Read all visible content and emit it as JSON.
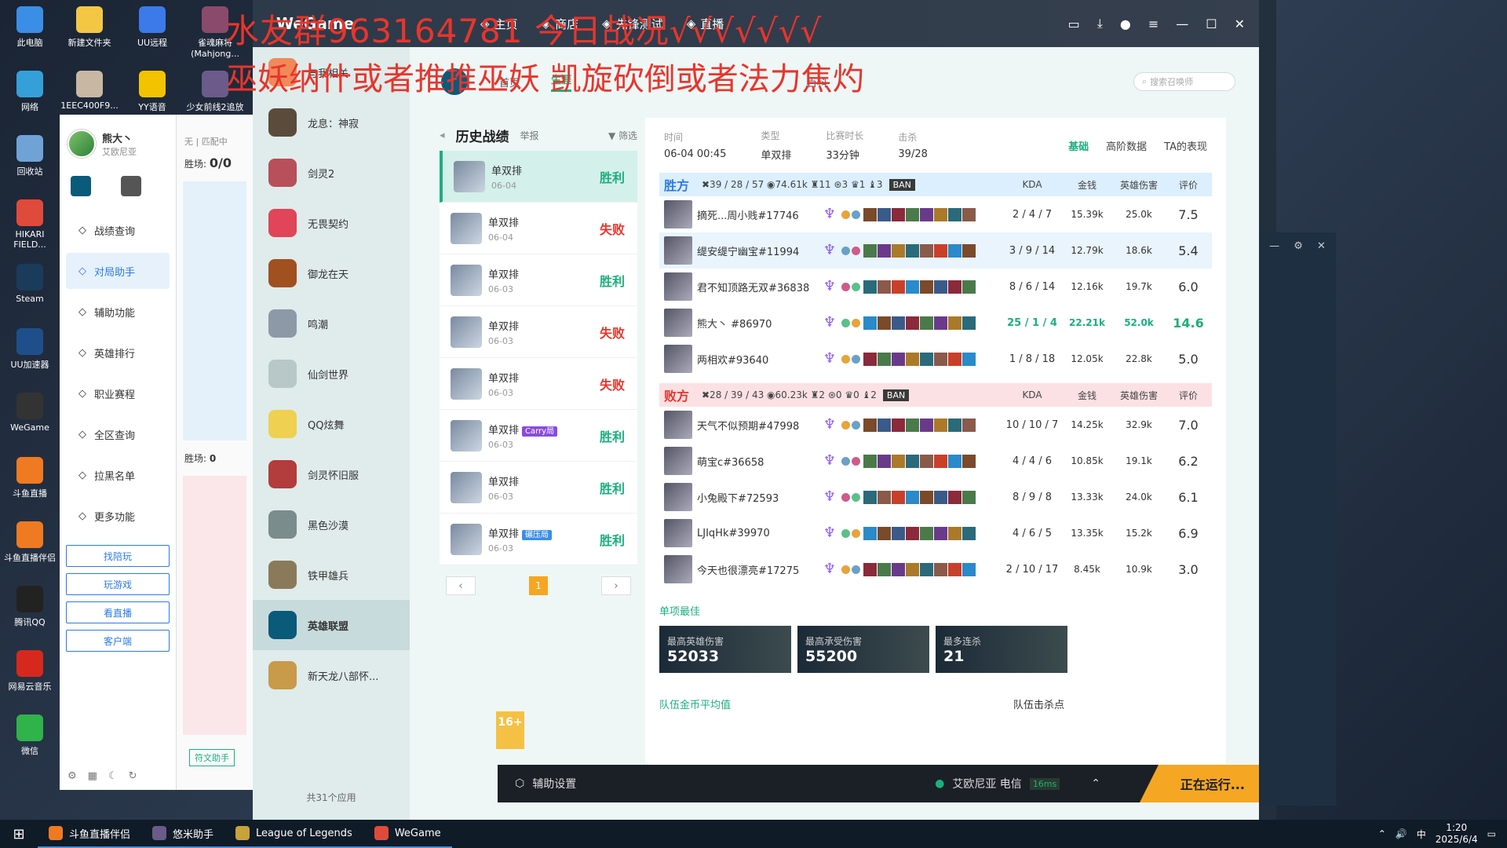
{
  "desktop": {
    "icons": [
      {
        "label": "此电脑",
        "color": "#3a8ee6"
      },
      {
        "label": "网络",
        "color": "#35a0d8"
      },
      {
        "label": "回收站",
        "color": "#6fa3d6"
      },
      {
        "label": "HIKARI FIELD...",
        "color": "#e04a3a"
      },
      {
        "label": "Steam",
        "color": "#1b3b5a"
      },
      {
        "label": "UU加速器",
        "color": "#1f4f8a"
      },
      {
        "label": "WeGame",
        "color": "#333"
      },
      {
        "label": "斗鱼直播",
        "color": "#f07a21"
      },
      {
        "label": "斗鱼直播伴侣",
        "color": "#f07a21"
      },
      {
        "label": "腾讯QQ",
        "color": "#222"
      },
      {
        "label": "网易云音乐",
        "color": "#d7281d"
      },
      {
        "label": "微信",
        "color": "#2fb34a"
      }
    ],
    "icons2": [
      [
        {
          "label": "新建文件夹",
          "color": "#f3c744"
        },
        {
          "label": "1EEC400F9...",
          "color": "#c8b7a3"
        }
      ],
      [
        {
          "label": "UU远程",
          "color": "#3b7ae8"
        },
        {
          "label": "YY语音",
          "color": "#f3c300"
        }
      ],
      [
        {
          "label": "雀魂麻将 (Mahjong...",
          "color": "#8a4a6b"
        },
        {
          "label": "少女前线2追放 ...",
          "color": "#6a5b8a"
        }
      ]
    ]
  },
  "overlay": {
    "line1": "水友群963164781 今日战况√√√√√√√",
    "line2": "巫妖纳什或者推推巫妖 凯旋砍倒或者法力焦灼"
  },
  "helper": {
    "user": "熊大丶",
    "region": "艾欧尼亚",
    "nav": [
      "战绩查询",
      "对局助手",
      "辅助功能",
      "英雄排行",
      "职业赛程",
      "全区查询",
      "拉黑名单",
      "更多功能"
    ],
    "active": 1,
    "buttons": [
      "找陪玩",
      "玩游戏",
      "看直播",
      "客户端"
    ],
    "strip": {
      "title": "无 | 匹配中",
      "wins_label": "胜场:",
      "wins": "0/0",
      "wins2": "0"
    },
    "fuwen": "符文助手"
  },
  "wegame": {
    "logo": "WeGame",
    "nav": [
      "主页",
      "商店",
      "先锋测试",
      "直播"
    ],
    "side": [
      {
        "label": "与我相关",
        "color": "#f08a5a"
      },
      {
        "label": "龙息：神寂",
        "color": "#5b4b3a"
      },
      {
        "label": "剑灵2",
        "color": "#b7505a"
      },
      {
        "label": "无畏契约",
        "color": "#e0455a"
      },
      {
        "label": "御龙在天",
        "color": "#a15020"
      },
      {
        "label": "鸣潮",
        "color": "#8d99a7"
      },
      {
        "label": "仙剑世界",
        "color": "#b8c8c8"
      },
      {
        "label": "QQ炫舞",
        "color": "#f0d050"
      },
      {
        "label": "剑灵怀旧服",
        "color": "#b33c3c"
      },
      {
        "label": "黑色沙漠",
        "color": "#7a8c8c"
      },
      {
        "label": "铁甲雄兵",
        "color": "#8a7a5a"
      },
      {
        "label": "英雄联盟",
        "color": "#0a5a7a"
      },
      {
        "label": "新天龙八部怀...",
        "color": "#c89a4a"
      }
    ],
    "side_active": 11,
    "total": "共31个应用",
    "subnav": [
      "首页",
      "生涯",
      "百科"
    ],
    "sub_active": 1,
    "search_placeholder": "搜索召唤师"
  },
  "history": {
    "title": "历史战绩",
    "report": "举报",
    "filter": "筛选",
    "matches": [
      {
        "mode": "单双排",
        "date": "06-04",
        "result": "胜利",
        "win": true,
        "tag": ""
      },
      {
        "mode": "单双排",
        "date": "06-04",
        "result": "失败",
        "win": false,
        "tag": ""
      },
      {
        "mode": "单双排",
        "date": "06-03",
        "result": "胜利",
        "win": true,
        "tag": ""
      },
      {
        "mode": "单双排",
        "date": "06-03",
        "result": "失败",
        "win": false,
        "tag": ""
      },
      {
        "mode": "单双排",
        "date": "06-03",
        "result": "失败",
        "win": false,
        "tag": ""
      },
      {
        "mode": "单双排",
        "date": "06-03",
        "result": "胜利",
        "win": true,
        "tag": "Carry局",
        "tagcolor": "#8a4ce0"
      },
      {
        "mode": "单双排",
        "date": "06-03",
        "result": "胜利",
        "win": true,
        "tag": ""
      },
      {
        "mode": "单双排",
        "date": "06-03",
        "result": "胜利",
        "win": true,
        "tag": "碾压局",
        "tagcolor": "#3a8ee6"
      }
    ],
    "page": "1"
  },
  "detail": {
    "time_label": "时间",
    "time": "06-04 00:45",
    "type_label": "类型",
    "type": "单双排",
    "dur_label": "比赛时长",
    "dur": "33分钟",
    "kills_label": "击杀",
    "kills": "39/28",
    "tabs": [
      "基础",
      "高阶数据",
      "TA的表现"
    ],
    "cols": {
      "kda": "KDA",
      "gold": "金钱",
      "dmg": "英雄伤害",
      "score": "评价"
    },
    "win": {
      "side": "胜方",
      "stats": "✖39 / 28 / 57  ◉74.61k  ♜11  ⊛3  ♛1  ♝3",
      "ban": "BAN",
      "players": [
        {
          "name": "摘死...周小贱#17746",
          "kda": "2 / 4 / 7",
          "gold": "15.39k",
          "dmg": "25.0k",
          "score": "7.5"
        },
        {
          "name": "缇安缇宁幽宝#11994",
          "kda": "3 / 9 / 14",
          "gold": "12.79k",
          "dmg": "18.6k",
          "score": "5.4"
        },
        {
          "name": "君不知顶路无双#36838",
          "kda": "8 / 6 / 14",
          "gold": "12.16k",
          "dmg": "19.7k",
          "score": "6.0"
        },
        {
          "name": "熊大丶 #86970",
          "kda": "25 / 1 / 4",
          "gold": "22.21k",
          "dmg": "52.0k",
          "score": "14.6",
          "hl": true
        },
        {
          "name": "两相欢#93640",
          "kda": "1 / 8 / 18",
          "gold": "12.05k",
          "dmg": "22.8k",
          "score": "5.0"
        }
      ]
    },
    "lose": {
      "side": "败方",
      "stats": "✖28 / 39 / 43  ◉60.23k  ♜2  ⊛0  ♛0  ♝2",
      "ban": "BAN",
      "players": [
        {
          "name": "天气不似预期#47998",
          "kda": "10 / 10 / 7",
          "gold": "14.25k",
          "dmg": "32.9k",
          "score": "7.0"
        },
        {
          "name": "萌宝c#36658",
          "kda": "4 / 4 / 6",
          "gold": "10.85k",
          "dmg": "19.1k",
          "score": "6.2"
        },
        {
          "name": "小兔殿下#72593",
          "kda": "8 / 9 / 8",
          "gold": "13.33k",
          "dmg": "24.0k",
          "score": "6.1"
        },
        {
          "name": "LJIqHk#39970",
          "kda": "4 / 6 / 5",
          "gold": "13.35k",
          "dmg": "15.2k",
          "score": "6.9"
        },
        {
          "name": "今天也很漂亮#17275",
          "kda": "2 / 10 / 17",
          "gold": "8.45k",
          "dmg": "10.9k",
          "score": "3.0"
        }
      ]
    },
    "best_title": "单项最佳",
    "best": [
      {
        "k": "最高英雄伤害",
        "v": "52033"
      },
      {
        "k": "最高承受伤害",
        "v": "55200"
      },
      {
        "k": "最多连杀",
        "v": "21"
      }
    ],
    "team_gold": "队伍金币平均值",
    "team_kill": "队伍击杀点"
  },
  "bottom": {
    "settings": "辅助设置",
    "server": "艾欧尼亚 电信",
    "ping": "16ms",
    "running": "正在运行..."
  },
  "age": "16+",
  "taskbar": {
    "apps": [
      "斗鱼直播伴侣",
      "悠米助手",
      "League of Legends",
      "WeGame"
    ],
    "time": "1:20",
    "date": "2025/6/4",
    "lang": "中"
  }
}
